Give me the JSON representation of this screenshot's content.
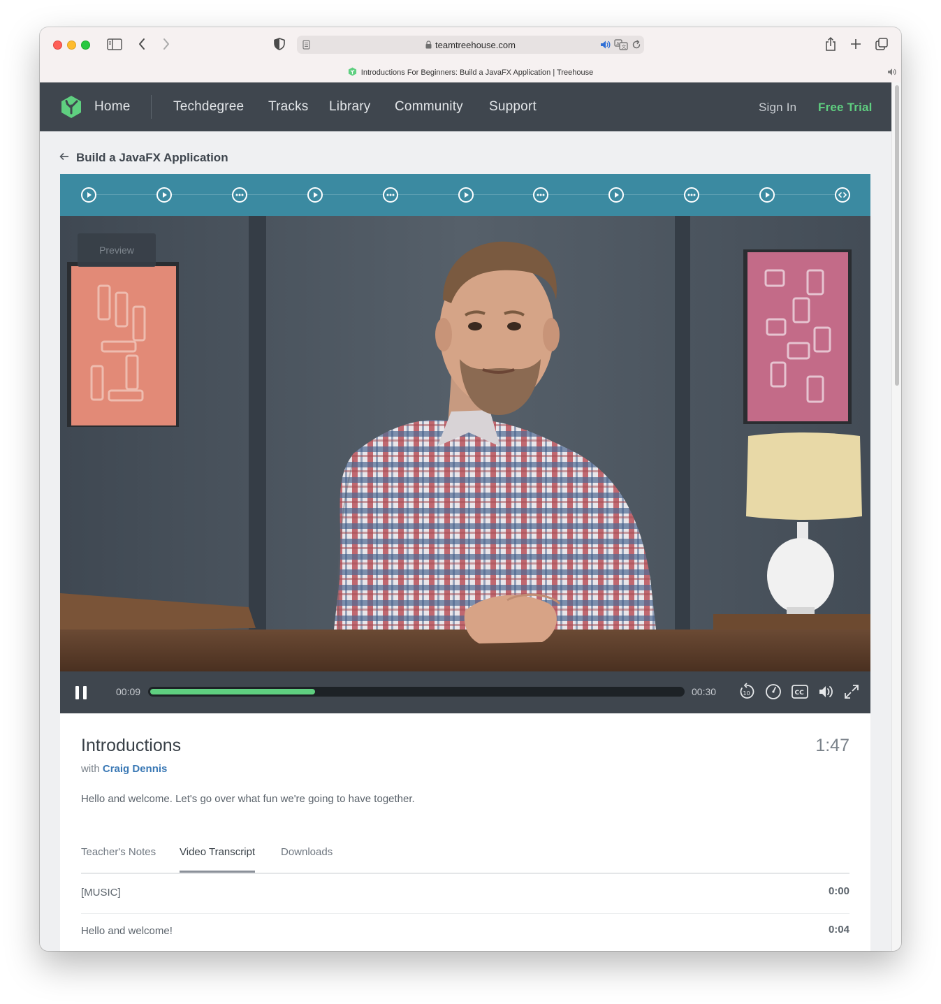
{
  "browser": {
    "url": "teamtreehouse.com",
    "tab_title": "Introductions For Beginners: Build a JavaFX Application | Treehouse",
    "icons": [
      "sidebar-icon",
      "back-icon",
      "forward-icon",
      "shield-icon",
      "reader-icon",
      "lock-icon",
      "speaker-icon",
      "translate-icon",
      "reload-icon",
      "share-icon",
      "new-tab-icon",
      "tabs-overview-icon"
    ]
  },
  "nav": {
    "home": "Home",
    "links": [
      "Techdegree",
      "Tracks",
      "Library",
      "Community",
      "Support"
    ],
    "sign_in": "Sign In",
    "free_trial": "Free Trial"
  },
  "course": {
    "back_title": "Build a JavaFX Application"
  },
  "steps": [
    {
      "type": "video"
    },
    {
      "type": "video"
    },
    {
      "type": "quiz"
    },
    {
      "type": "video"
    },
    {
      "type": "quiz"
    },
    {
      "type": "video"
    },
    {
      "type": "quiz"
    },
    {
      "type": "video"
    },
    {
      "type": "quiz"
    },
    {
      "type": "video"
    },
    {
      "type": "code-challenge"
    }
  ],
  "player": {
    "preview_label": "Preview",
    "current_time": "00:09",
    "end_time": "00:30",
    "progress_fraction": 0.31
  },
  "lesson": {
    "title": "Introductions",
    "duration": "1:47",
    "with_label": "with",
    "author": "Craig Dennis",
    "description": "Hello and welcome. Let's go over what fun we're going to have together."
  },
  "tabs": [
    "Teacher's Notes",
    "Video Transcript",
    "Downloads"
  ],
  "active_tab": "Video Transcript",
  "transcript": [
    {
      "text": "[MUSIC]",
      "time": "0:00"
    },
    {
      "text": "Hello and welcome!",
      "time": "0:04"
    }
  ],
  "colors": {
    "nav_bg": "#3f464e",
    "step_bar": "#3b8aa1",
    "accent_green": "#5fcf80",
    "author_link": "#3b79b5"
  }
}
